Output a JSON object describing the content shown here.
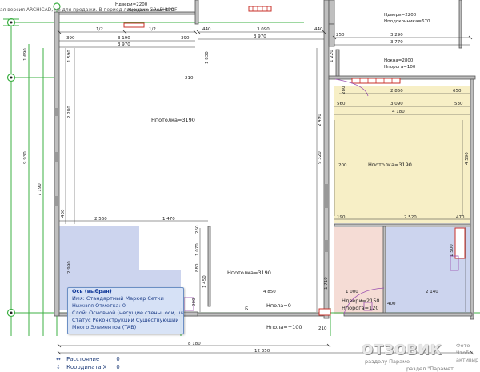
{
  "watermark": "ая версия ARCHICAD, не для продажи. В период лицензии GRAPHISOF",
  "top": {
    "door_height_left": "Hдвери=2200",
    "window_sill_left": "Hподоконника=670",
    "door_height_right": "Hдвери=2200",
    "window_sill_right": "Hподоконника=670",
    "window_height_right": "Hокна=2800",
    "window_sill_right2": "Hпорога=100"
  },
  "dims": {
    "half_a": "1/2",
    "half_b": "1/2",
    "d3190": "3 190",
    "d3970_a": "3 970",
    "d3090": "3 090",
    "d3970_b": "3 970",
    "d390": "390",
    "d390b": "390",
    "d440": "440",
    "d440b": "440",
    "d250": "250",
    "d1220": "1 220",
    "d3290": "3 290",
    "d3770": "3 770",
    "d2850": "2 850",
    "d4180": "4 180",
    "d3090b": "3 090",
    "d560": "560",
    "d650": "650",
    "d530": "530",
    "d650b": "650",
    "d280": "280",
    "d210": "210",
    "d1690": "1 690",
    "d1590": "1 590",
    "d8930": "9 930",
    "d7190": "7 190",
    "d2280": "2 280",
    "d2490": "2 490",
    "d4590": "4 590",
    "d9320": "9 320",
    "d1830": "1 830",
    "d2560": "2 560",
    "d1470": "1 470",
    "d2990": "2 990",
    "d260": "260",
    "d1070": "1 070",
    "d880": "880",
    "d900": "900",
    "d1450": "1 450",
    "d2520": "2 520",
    "d470": "470",
    "d1500": "1 500",
    "d4850": "4 850",
    "d1000": "1 000",
    "d2140": "2 140",
    "d400": "400",
    "d1710": "1 710",
    "d8180": "8 180",
    "d12350": "12 350",
    "d210b": "210",
    "d200": "200",
    "d190": "190",
    "d400b": "400"
  },
  "rooms": {
    "ceiling_left": "Hпотолка=3190",
    "ceiling_right": "Hпотолка=3190",
    "ceiling_bottom": "Hпотолка=3190",
    "floor_zero": "Hпола=0",
    "door_2150": "Hдвери=2150",
    "sill_120": "Hпорога=120",
    "floor_plus100": "Hпола=+100",
    "marker_b": "Б"
  },
  "tooltip": {
    "title": "Ось (выбран)",
    "line1": "Имя: Стандартный Маркер Сетки",
    "line2": "Нижняя Отметка: 0",
    "line3": "Слой: Основной (несущие стены, оси, шахты)",
    "line4": "Статус Реконструкции Существующий",
    "line5": "Много Элементов (TAB)"
  },
  "status": {
    "distance_label": "Расстояние",
    "distance_value": "0",
    "coordx_label": "Координата X",
    "coordx_value": "0"
  },
  "logo": {
    "brand": "ОТЗОВИК",
    "side": "Фото Чтобы активир",
    "sub": "разделу Параме",
    "sub2": "раздел \"Парамет"
  },
  "colors": {
    "axis_green": "#3cb043",
    "room_lavender": "#ccd4ee",
    "room_yellow": "#f7efc6",
    "room_pink": "#f5dcd5",
    "window_red": "#c8302a",
    "door_magenta": "#9a4fb0",
    "wall_gray": "#8a8a8a"
  }
}
